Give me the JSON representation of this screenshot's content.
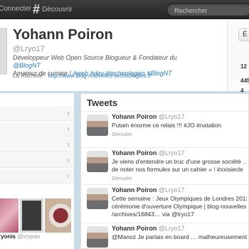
{
  "topbar": {
    "connect_label": "Connecter",
    "discover_label": "Découvrir",
    "search_placeholder": "Rechercher"
  },
  "profile": {
    "name": "Yohann Poiron",
    "handle": "@Lryo17",
    "bio_line1_text": "Développeur Web Open Source Blogueur & Fondateur du ",
    "bio_line1_link": "@BlogNT",
    "bio_line2_text": "Amateur de cuisine ! ",
    "bio_line2_tags": "#web #dev #technologies #BlogNT",
    "location": "La Rochelle",
    "location_sep": " · ",
    "website": "http://www.blog-nouvelles-technologies.fr",
    "edit_label": "É",
    "stats": [
      "12",
      "445",
      "4"
    ]
  },
  "left": {
    "follower_name": "ryonis",
    "follower_handle": "@vrypan"
  },
  "tweets": {
    "title": "Tweets",
    "expand_label": "Dérouler",
    "items": [
      {
        "name": "Yohann Poiron",
        "handle": "@Lryo17",
        "line1": "Putain énorme ce relais !!! #JO #natation",
        "line2": "",
        "line3": ""
      },
      {
        "name": "Yohann Poiron",
        "handle": "@Lryo17",
        "line1": "Je viens d'entendre un truc d'une grosse société …",
        "line2": "de noter nos formules sur un cahier » ! #xxisiecle",
        "line3": ""
      },
      {
        "name": "Yohann Poiron",
        "handle": "@Lryo17",
        "line1": "Cette semaine : Jeux Olympiques de Londres 2012 :",
        "line2": "cérémonie d'ouverture Olympique | blog-nouvelles-te",
        "line3": "/archives/16843… via @lryo17"
      },
      {
        "name": "Yohann Poiron",
        "handle": "@Lryo17",
        "line1": "@Manoz Je parlais en board … malheureusement pla",
        "line2": "",
        "line3": ""
      }
    ]
  }
}
